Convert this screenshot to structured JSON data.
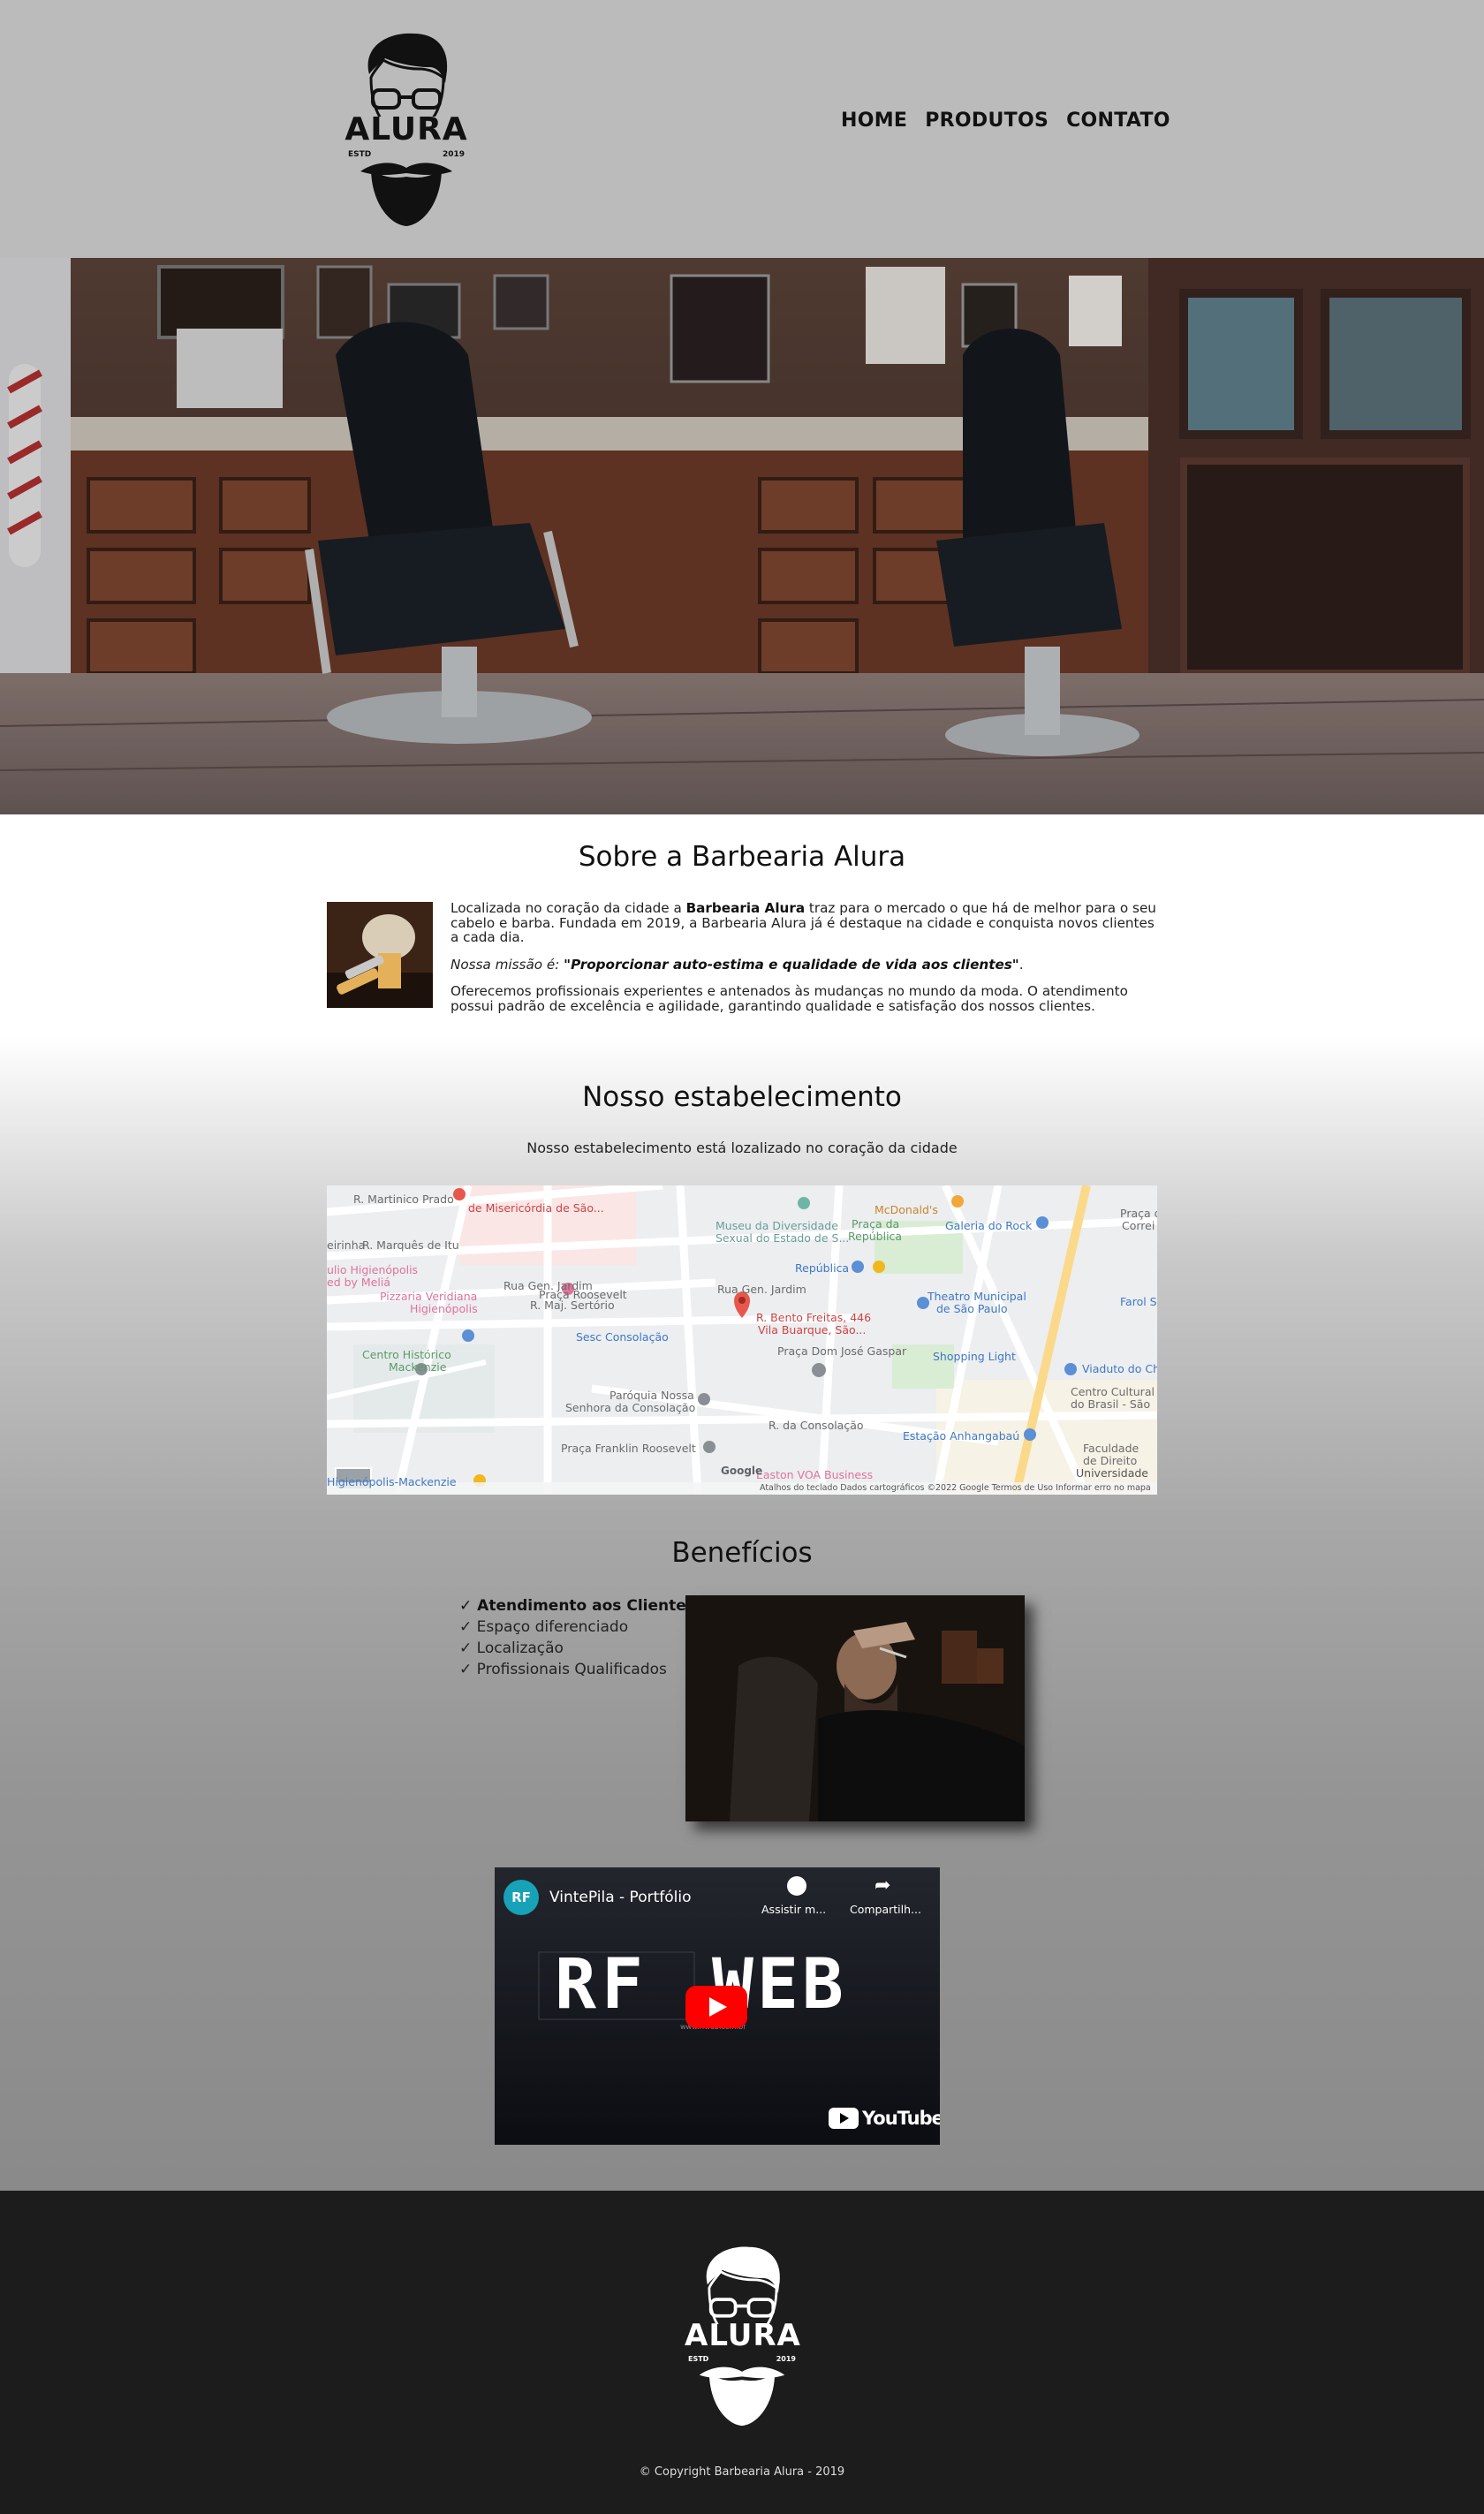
{
  "header": {
    "logo": {
      "icon": "bearded-man-logo",
      "name": "ALURA",
      "left_tag": "ESTD",
      "right_tag": "2019"
    },
    "nav": [
      "HOME",
      "PRODUTOS",
      "CONTATO"
    ]
  },
  "hero": {
    "icon": "barbershop-photo"
  },
  "about": {
    "title": "Sobre a Barbearia Alura",
    "p1_pre": "Localizada no coração da cidade a ",
    "p1_bold": "Barbearia Alura",
    "p1_post": " traz para o mercado o que há de melhor para o seu cabelo e barba. Fundada em 2019, a Barbearia Alura já é destaque na cidade e conquista novos clientes a cada dia.",
    "mission_label": "Nossa missão é: ",
    "mission_text": "\"Proporcionar auto-estima e qualidade de vida aos clientes\"",
    "mission_end": ".",
    "p3": "Oferecemos profissionais experientes e antenados às mudanças no mundo da moda. O atendimento possui padrão de excelência e agilidade, garantindo qualidade e satisfação dos nossos clientes."
  },
  "estab": {
    "title": "Nosso estabelecimento",
    "subtitle": "Nosso estabelecimento está lozalizado no coração da cidade"
  },
  "map": {
    "labels": {
      "martinico": "R. Martinico Prado",
      "marques": "R. Marquês de Itu",
      "gen_jardim": "Rua Gen. Jardim",
      "gen_jardim2": "Rua Gen. Jardim",
      "roosevelt": "Praça Roosevelt",
      "misericordia": "de Misericórdia de São...",
      "museu": "Museu da Diversidade",
      "museu2": "Sexual do Estado de S...",
      "mcdonalds": "McDonald's",
      "republica_praca": "Praça da",
      "republica_praca2": "República",
      "galeria": "Galeria do Rock",
      "republica": "República",
      "theatro": "Theatro Municipal",
      "theatro2": "de São Paulo",
      "pizzaria": "Pizzaria Veridiana",
      "pizzaria2": "Higienópolis",
      "sesc": "Sesc Consolação",
      "pin": "R. Bento Freitas, 446",
      "pin2": "Vila Buarque, São...",
      "dom_jose": "Praça Dom José Gaspar",
      "shopping": "Shopping Light",
      "viaduto": "Viaduto do Ch",
      "centro_hist": "Centro Histórico",
      "centro_hist2": "Mackenzie",
      "paroquia": "Paróquia Nossa",
      "paroquia2": "Senhora da Consolação",
      "consolacao": "R. da Consolação",
      "anhangabau": "Estação Anhangabaú",
      "franklin": "Praça Franklin Roosevelt",
      "mackenzie": "Higienópolis-Mackenzie",
      "voa": "Easton VOA Business",
      "centro_cultural": "Centro Cultural",
      "centro_cultural2": "do Brasil - São",
      "faculdade": "Faculdade",
      "faculdade2": "de Direito",
      "universidade": "Universidade",
      "google": "Google",
      "footer": "Atalhos do teclado   Dados cartográficos ©2022 Google   Termos de Uso   Informar erro no mapa",
      "farol": "Farol S",
      "higienopolis_side": "ulio Higienópolis",
      "melia": "ed by Meliá",
      "esiarinha": "eirinha",
      "sertorio": "R. Maj. Sertório",
      "praca_corr": "Praça d",
      "praca_corr2": "Correi"
    }
  },
  "benefits": {
    "title": "Benefícios",
    "items": [
      "Atendimento aos Clientes",
      "Espaço diferenciado",
      "Localização",
      "Profissionais Qualificados"
    ],
    "check": "✓",
    "icon": "beard-trim-photo"
  },
  "video": {
    "channel_icon": "rf-channel-avatar",
    "title": "VintePila - Portfólio",
    "watch_later": "Assistir m...",
    "share": "Compartilh...",
    "brand_left": "RF",
    "brand_right": "WEB",
    "url": "www.rfweb.com.br",
    "youtube": "YouTube"
  },
  "footer": {
    "copyright": "© Copyright Barbearia Alura - 2019"
  },
  "colors": {
    "header_bg": "#bbbbbb",
    "footer_bg": "#1c1c1c",
    "pin": "#e8574d",
    "youtube_red": "#ff0000"
  }
}
